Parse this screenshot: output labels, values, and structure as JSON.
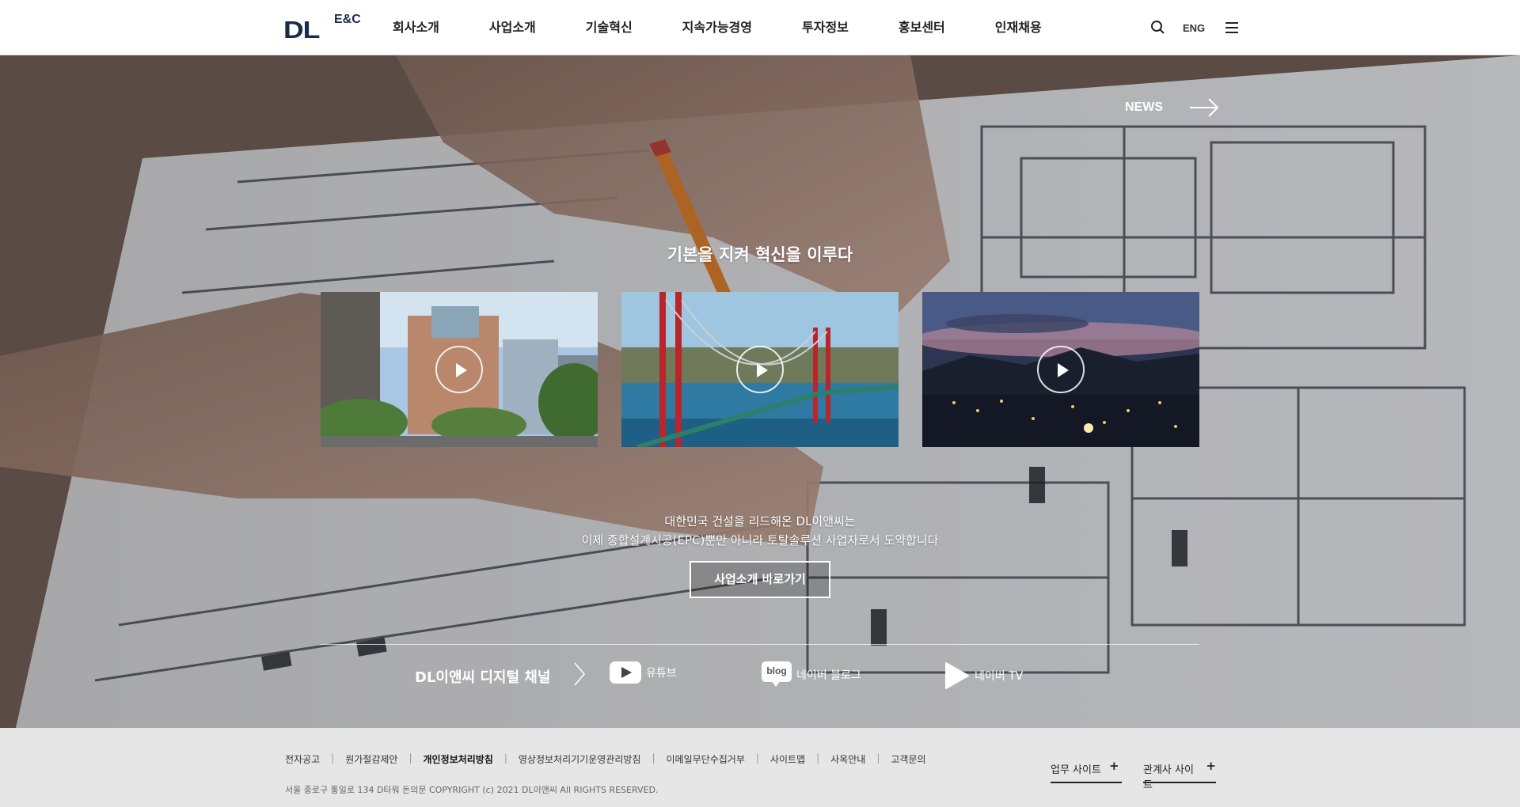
{
  "header": {
    "logo_main": "DL",
    "logo_sub": "E&C",
    "nav": [
      "회사소개",
      "사업소개",
      "기술혁신",
      "지속가능경영",
      "투자정보",
      "홍보센터",
      "인재채용"
    ],
    "lang_label": "ENG",
    "icons": [
      "search-icon",
      "menu-icon"
    ]
  },
  "hero": {
    "news_label": "NEWS",
    "slogan": "기본을 지켜 혁신을 이루다",
    "videos": [
      {
        "scene": "office-buildings"
      },
      {
        "scene": "suspension-bridge"
      },
      {
        "scene": "night-city-skyline"
      }
    ],
    "description_line1": "대한민국 건설을 리드해온 DL이앤씨는",
    "description_line2": "이제 종합설계시공(EPC)뿐만 아니라 토탈솔루션 사업자로서 도약합니다",
    "cta_label": "사업소개 바로가기",
    "channels_title": "DL이앤씨 디지털 채널",
    "channels": [
      {
        "label": "유튜브",
        "icon": "youtube-icon"
      },
      {
        "label": "네이버 블로그",
        "icon": "blog-icon",
        "icon_text": "blog"
      },
      {
        "label": "네이버 TV",
        "icon": "naver-tv-icon"
      }
    ]
  },
  "footer": {
    "links": [
      "전자공고",
      "원가절감제안",
      "개인정보처리방침",
      "영상정보처리기기운영관리방침",
      "이메일무단수집거부",
      "사이트맵",
      "사옥안내",
      "고객문의"
    ],
    "copyright": "서울 종로구 통일로 134 D타워 돈의문 COPYRIGHT (c) 2021 DL이앤씨 All RIGHTS RESERVED.",
    "work_site_label": "업무 사이트",
    "affiliate_site_label": "관계사 사이트",
    "plus": "+"
  }
}
